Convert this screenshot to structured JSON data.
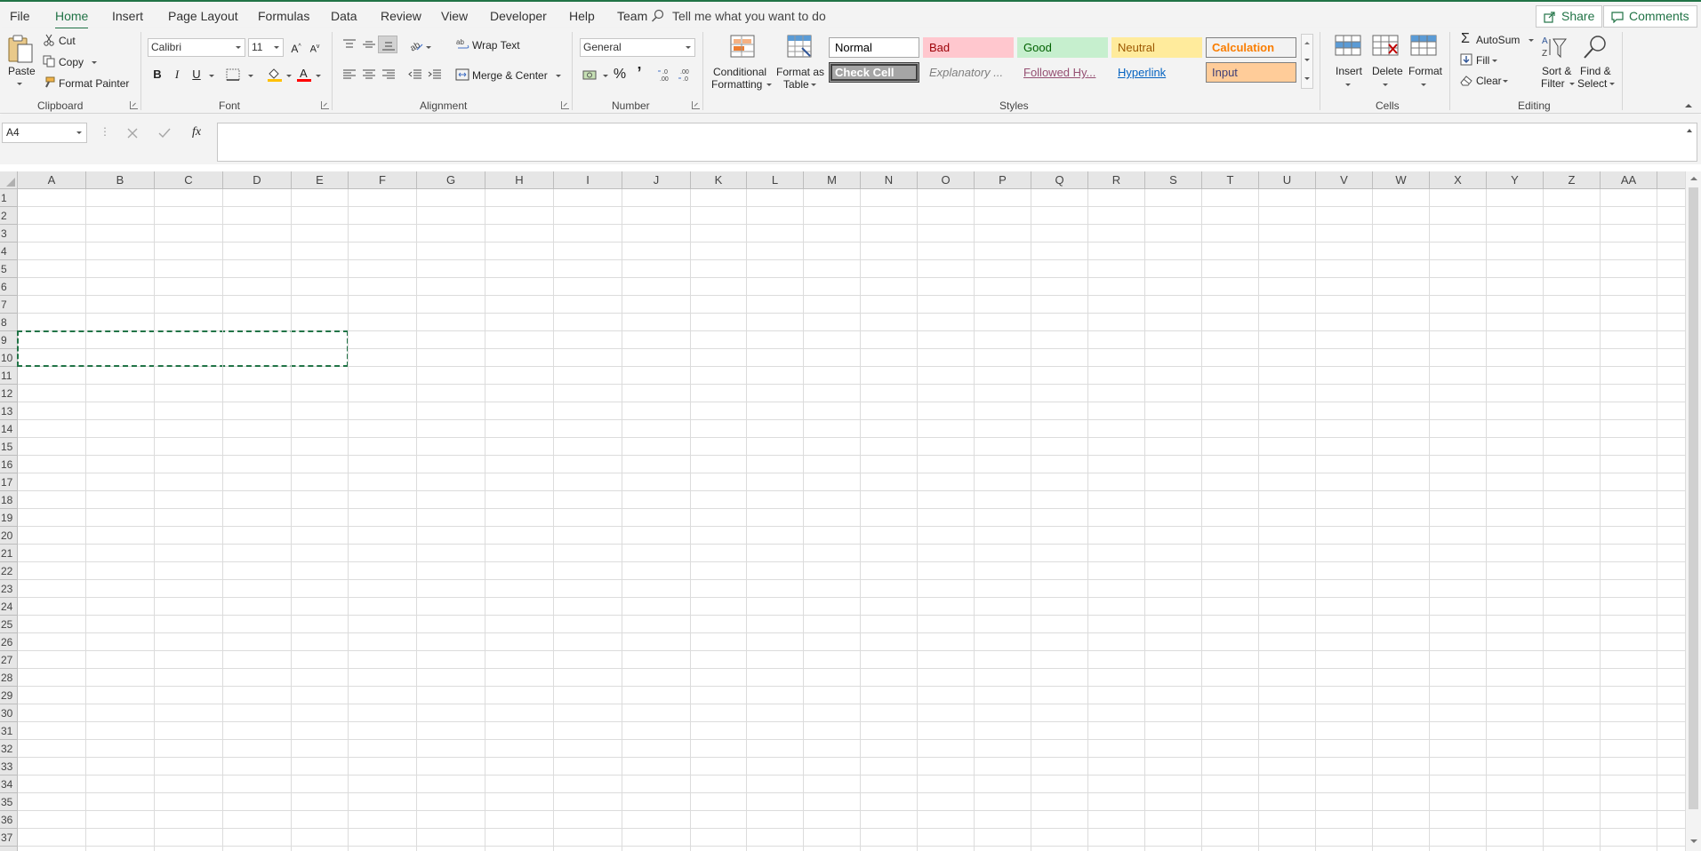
{
  "menu": {
    "tabs": [
      "File",
      "Home",
      "Insert",
      "Page Layout",
      "Formulas",
      "Data",
      "Review",
      "View",
      "Developer",
      "Help",
      "Team"
    ],
    "active": "Home",
    "tell_me": "Tell me what you want to do",
    "share": "Share",
    "comments": "Comments"
  },
  "clipboard": {
    "paste": "Paste",
    "cut": "Cut",
    "copy": "Copy",
    "format_painter": "Format Painter",
    "label": "Clipboard"
  },
  "font": {
    "name": "Calibri",
    "size": "11",
    "bold": "B",
    "italic": "I",
    "underline": "U",
    "label": "Font"
  },
  "alignment": {
    "wrap_text": "Wrap Text",
    "merge_center": "Merge & Center",
    "label": "Alignment"
  },
  "number": {
    "format": "General",
    "percent": "%",
    "comma": "’",
    "label": "Number"
  },
  "styles": {
    "conditional": [
      "Conditional",
      "Formatting"
    ],
    "format_table": [
      "Format as",
      "Table"
    ],
    "cells": [
      {
        "text": "Normal",
        "bg": "#ffffff",
        "fg": "#000000",
        "border": "#a6a6a6"
      },
      {
        "text": "Bad",
        "bg": "#ffc7ce",
        "fg": "#9c0006",
        "border": "#ffc7ce"
      },
      {
        "text": "Good",
        "bg": "#c6efce",
        "fg": "#006100",
        "border": "#c6efce"
      },
      {
        "text": "Neutral",
        "bg": "#ffeb9c",
        "fg": "#9c5700",
        "border": "#ffeb9c"
      },
      {
        "text": "Calculation",
        "bg": "#f2f2f2",
        "fg": "#fa7d00",
        "border": "#7f7f7f"
      },
      {
        "text": "Check Cell",
        "bg": "#a5a5a5",
        "fg": "#ffffff",
        "border": "#3f3f3f"
      },
      {
        "text": "Explanatory ...",
        "bg": "#f3f3f3",
        "fg": "#7f7f7f",
        "border": "#f3f3f3"
      },
      {
        "text": "Followed Hy...",
        "bg": "#f3f3f3",
        "fg": "#954f72",
        "border": "#f3f3f3"
      },
      {
        "text": "Hyperlink",
        "bg": "#f3f3f3",
        "fg": "#0563c1",
        "border": "#f3f3f3"
      },
      {
        "text": "Input",
        "bg": "#ffcc99",
        "fg": "#3f3f76",
        "border": "#7f7f7f"
      }
    ],
    "label": "Styles"
  },
  "cells_group": {
    "insert": "Insert",
    "delete": "Delete",
    "format": "Format",
    "label": "Cells"
  },
  "editing": {
    "autosum": "AutoSum",
    "fill": "Fill",
    "clear": "Clear",
    "sort_filter": [
      "Sort &",
      "Filter"
    ],
    "find_select": [
      "Find &",
      "Select"
    ],
    "label": "Editing"
  },
  "formula_bar": {
    "name_box": "A4",
    "fx": "fx",
    "formula": ""
  },
  "sheet": {
    "columns": [
      "A",
      "B",
      "C",
      "D",
      "E",
      "F",
      "G",
      "H",
      "I",
      "J",
      "K",
      "L",
      "M",
      "N",
      "O",
      "P",
      "Q",
      "R",
      "S",
      "T",
      "U",
      "V",
      "W",
      "X",
      "Y",
      "Z",
      "AA"
    ],
    "rows": [
      1,
      2,
      3,
      4,
      5,
      6,
      7,
      8,
      9,
      10,
      11,
      12,
      13,
      14,
      15,
      16,
      17,
      18,
      19,
      20,
      21,
      22,
      23,
      24,
      25,
      26,
      27,
      28,
      29,
      30,
      31,
      32,
      33,
      34,
      35,
      36,
      37
    ],
    "marquee_range": "A9:E10"
  },
  "colors": {
    "accent": "#217346"
  }
}
